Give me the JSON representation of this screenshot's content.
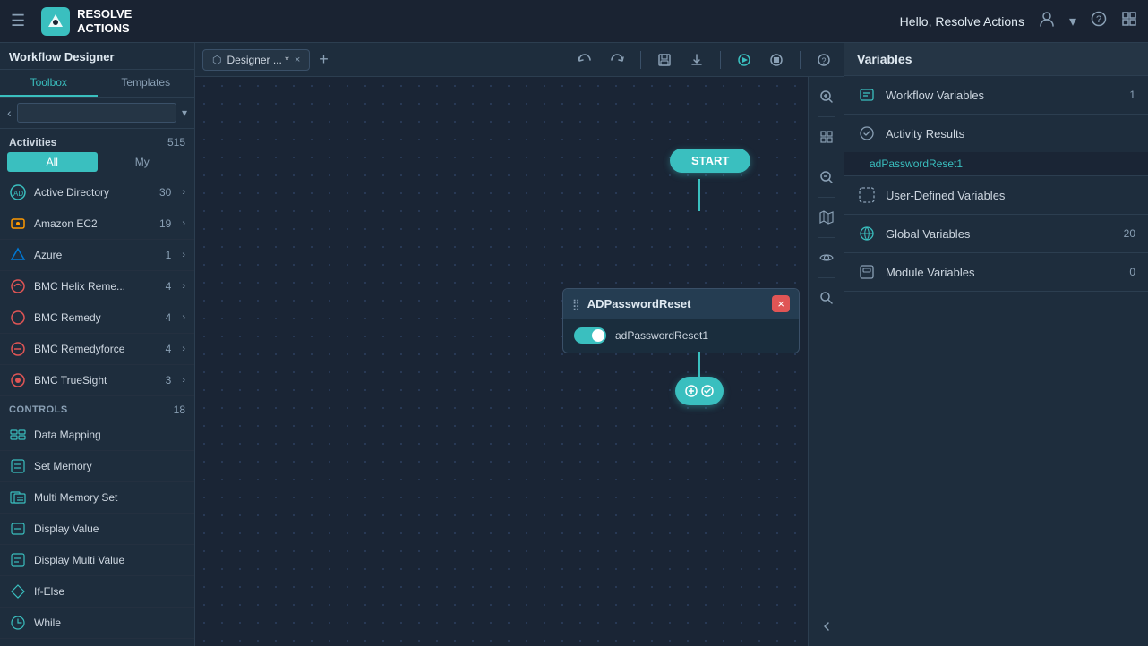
{
  "topnav": {
    "hamburger": "☰",
    "logo_text_line1": "RESOLVE",
    "logo_text_line2": "ACTIONS",
    "logo_abbr": "RA",
    "greeting": "Hello, Resolve Actions",
    "user_icon": "👤",
    "help_icon": "?",
    "settings_icon": "⊞"
  },
  "tabbar": {
    "tab_label": "Designer ... *",
    "tab_close": "×",
    "tab_add": "+",
    "actions": {
      "undo": "↩",
      "redo": "↪",
      "save": "💾",
      "download": "⬇",
      "play": "▶",
      "stop": "⏹",
      "help": "?"
    }
  },
  "sidebar": {
    "title": "Workflow Designer",
    "tabs": [
      {
        "id": "toolbox",
        "label": "Toolbox"
      },
      {
        "id": "templates",
        "label": "Templates"
      }
    ],
    "search_placeholder": "",
    "activities_label": "Activities",
    "activities_count": "515",
    "filter_all": "All",
    "filter_my": "My",
    "activity_items": [
      {
        "label": "Active Directory",
        "count": "30",
        "icon": "ad"
      },
      {
        "label": "Amazon EC2",
        "count": "19",
        "icon": "aws"
      },
      {
        "label": "Azure",
        "count": "1",
        "icon": "azure"
      },
      {
        "label": "BMC Helix Reme...",
        "count": "4",
        "icon": "bmc"
      },
      {
        "label": "BMC Remedy",
        "count": "4",
        "icon": "bmc"
      },
      {
        "label": "BMC Remedyforce",
        "count": "4",
        "icon": "bmc"
      },
      {
        "label": "BMC TrueSight",
        "count": "3",
        "icon": "bmc"
      }
    ],
    "controls_label": "Controls",
    "controls_count": "18",
    "control_items": [
      {
        "label": "Data Mapping",
        "icon": "dm"
      },
      {
        "label": "Set Memory",
        "icon": "sm"
      },
      {
        "label": "Multi Memory Set",
        "icon": "mms"
      },
      {
        "label": "Display Value",
        "icon": "dv"
      },
      {
        "label": "Display Multi Value",
        "icon": "dmv"
      },
      {
        "label": "If-Else",
        "icon": "ie"
      },
      {
        "label": "While",
        "icon": "wh"
      }
    ]
  },
  "canvas": {
    "start_label": "START",
    "node_title": "ADPasswordReset",
    "node_instance": "adPasswordReset1",
    "node_close": "×"
  },
  "variables": {
    "panel_title": "Variables",
    "sections": [
      {
        "id": "workflow",
        "label": "Workflow Variables",
        "count": "1"
      },
      {
        "id": "activity",
        "label": "Activity Results",
        "count": ""
      },
      {
        "id": "user_defined",
        "label": "User-Defined Variables",
        "count": ""
      },
      {
        "id": "global",
        "label": "Global Variables",
        "count": "20"
      },
      {
        "id": "module",
        "label": "Module Variables",
        "count": "0"
      }
    ],
    "activity_result": "adPasswordReset1"
  }
}
